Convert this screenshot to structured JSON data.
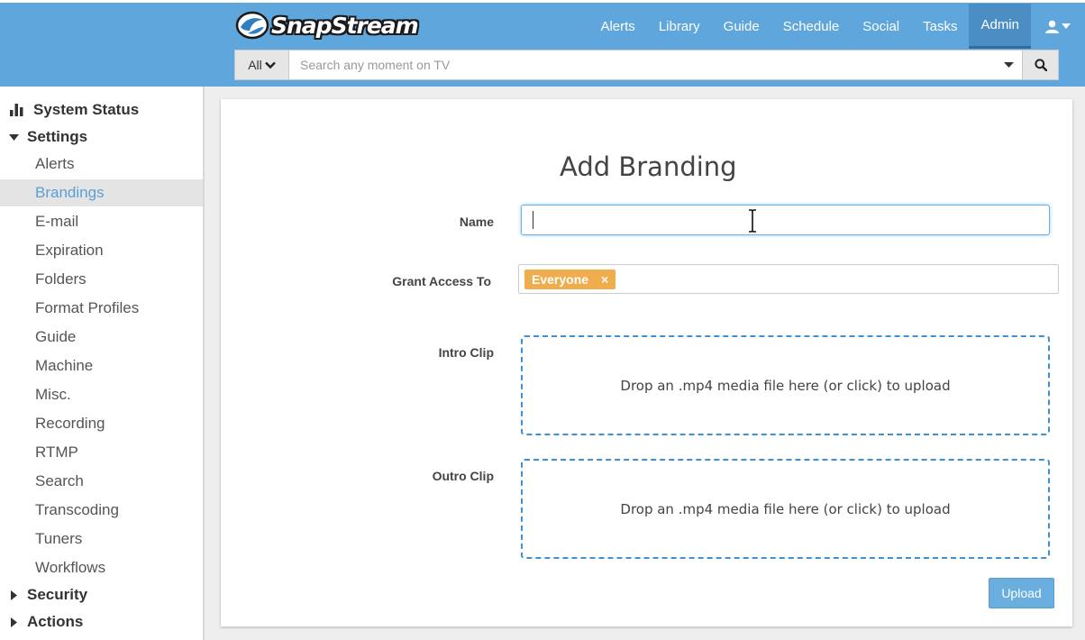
{
  "app": {
    "name": "SnapStream"
  },
  "nav": {
    "items": [
      {
        "label": "Alerts",
        "active": false
      },
      {
        "label": "Library",
        "active": false
      },
      {
        "label": "Guide",
        "active": false
      },
      {
        "label": "Schedule",
        "active": false
      },
      {
        "label": "Social",
        "active": false
      },
      {
        "label": "Tasks",
        "active": false
      },
      {
        "label": "Admin",
        "active": true
      }
    ],
    "user_icon": "user-icon"
  },
  "search": {
    "filter": "All",
    "placeholder": "Search any moment on TV",
    "value": ""
  },
  "sidebar": {
    "system_status": "System Status",
    "settings": "Settings",
    "settings_items": [
      "Alerts",
      "Brandings",
      "E-mail",
      "Expiration",
      "Folders",
      "Format Profiles",
      "Guide",
      "Machine",
      "Misc.",
      "Recording",
      "RTMP",
      "Search",
      "Transcoding",
      "Tuners",
      "Workflows"
    ],
    "selected": "Brandings",
    "security": "Security",
    "actions": "Actions"
  },
  "form": {
    "title": "Add Branding",
    "name_label": "Name",
    "name_value": "",
    "grant_label": "Grant Access To",
    "grant_tags": [
      "Everyone"
    ],
    "intro_label": "Intro Clip",
    "intro_drop": "Drop an .mp4 media file here (or click) to upload",
    "outro_label": "Outro Clip",
    "outro_drop": "Drop an .mp4 media file here (or click) to upload",
    "upload_label": "Upload"
  },
  "colors": {
    "header": "#5ea6dc",
    "accent": "#5aa0d8",
    "tag": "#f0ad4e",
    "dropzone_border": "#3d8fd6"
  }
}
